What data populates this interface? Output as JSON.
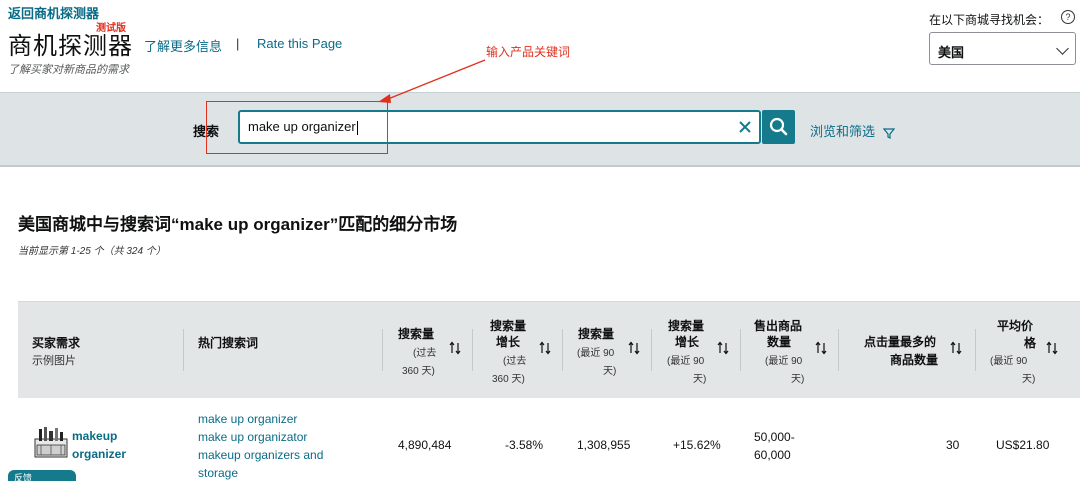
{
  "header": {
    "back_link": "返回商机探测器",
    "beta_badge": "测试版",
    "title": "商机探测器",
    "learn_more": "了解更多信息",
    "separator": "|",
    "rate_page": "Rate this Page",
    "subtitle": "了解买家对新商品的需求"
  },
  "market": {
    "label": "在以下商城寻找机会：",
    "help": "?",
    "selected": "美国"
  },
  "annotation": {
    "text": "输入产品关键词",
    "color": "#e0301e"
  },
  "search": {
    "label": "搜索",
    "value": "make up organizer",
    "browse_filter": "浏览和筛选"
  },
  "results": {
    "title": "美国商城中与搜索词“make up organizer”匹配的细分市场",
    "count": "当前显示第 1-25 个（共 324 个）"
  },
  "table": {
    "columns": [
      {
        "line1": "买家需求",
        "line2": "示例图片"
      },
      {
        "line1": "热门搜索词"
      },
      {
        "line1": "搜索量",
        "sub": [
          "(过去",
          "360 天)"
        ]
      },
      {
        "line1": "搜索量",
        "line2": "增长",
        "sub": [
          "(过去",
          "360 天)"
        ]
      },
      {
        "line1": "搜索量",
        "sub": [
          "(最近 90",
          "天)"
        ]
      },
      {
        "line1": "搜索量",
        "line2": "增长",
        "sub": [
          "(最近 90",
          "天)"
        ]
      },
      {
        "line1": "售出商品",
        "line2": "数量",
        "sub": [
          "(最近 90",
          "天)"
        ]
      },
      {
        "line1": "点击量最多的",
        "line2": "商品数量"
      },
      {
        "line1": "平均价",
        "line2": "格",
        "sub": [
          "(最近 90",
          "天)"
        ]
      }
    ],
    "rows": [
      {
        "need": [
          "makeup",
          "organizer"
        ],
        "keywords": [
          "make up organizer",
          "make up organizator",
          "makeup organizers and",
          "storage"
        ],
        "search_volume_360": "4,890,484",
        "growth_360": "-3.58%",
        "search_volume_90": "1,308,955",
        "growth_90": "+15.62%",
        "units_sold": [
          "50,000-",
          "60,000"
        ],
        "most_clicked": "30",
        "avg_price": "US$21.80"
      }
    ]
  },
  "feedback": {
    "label": "反馈"
  }
}
